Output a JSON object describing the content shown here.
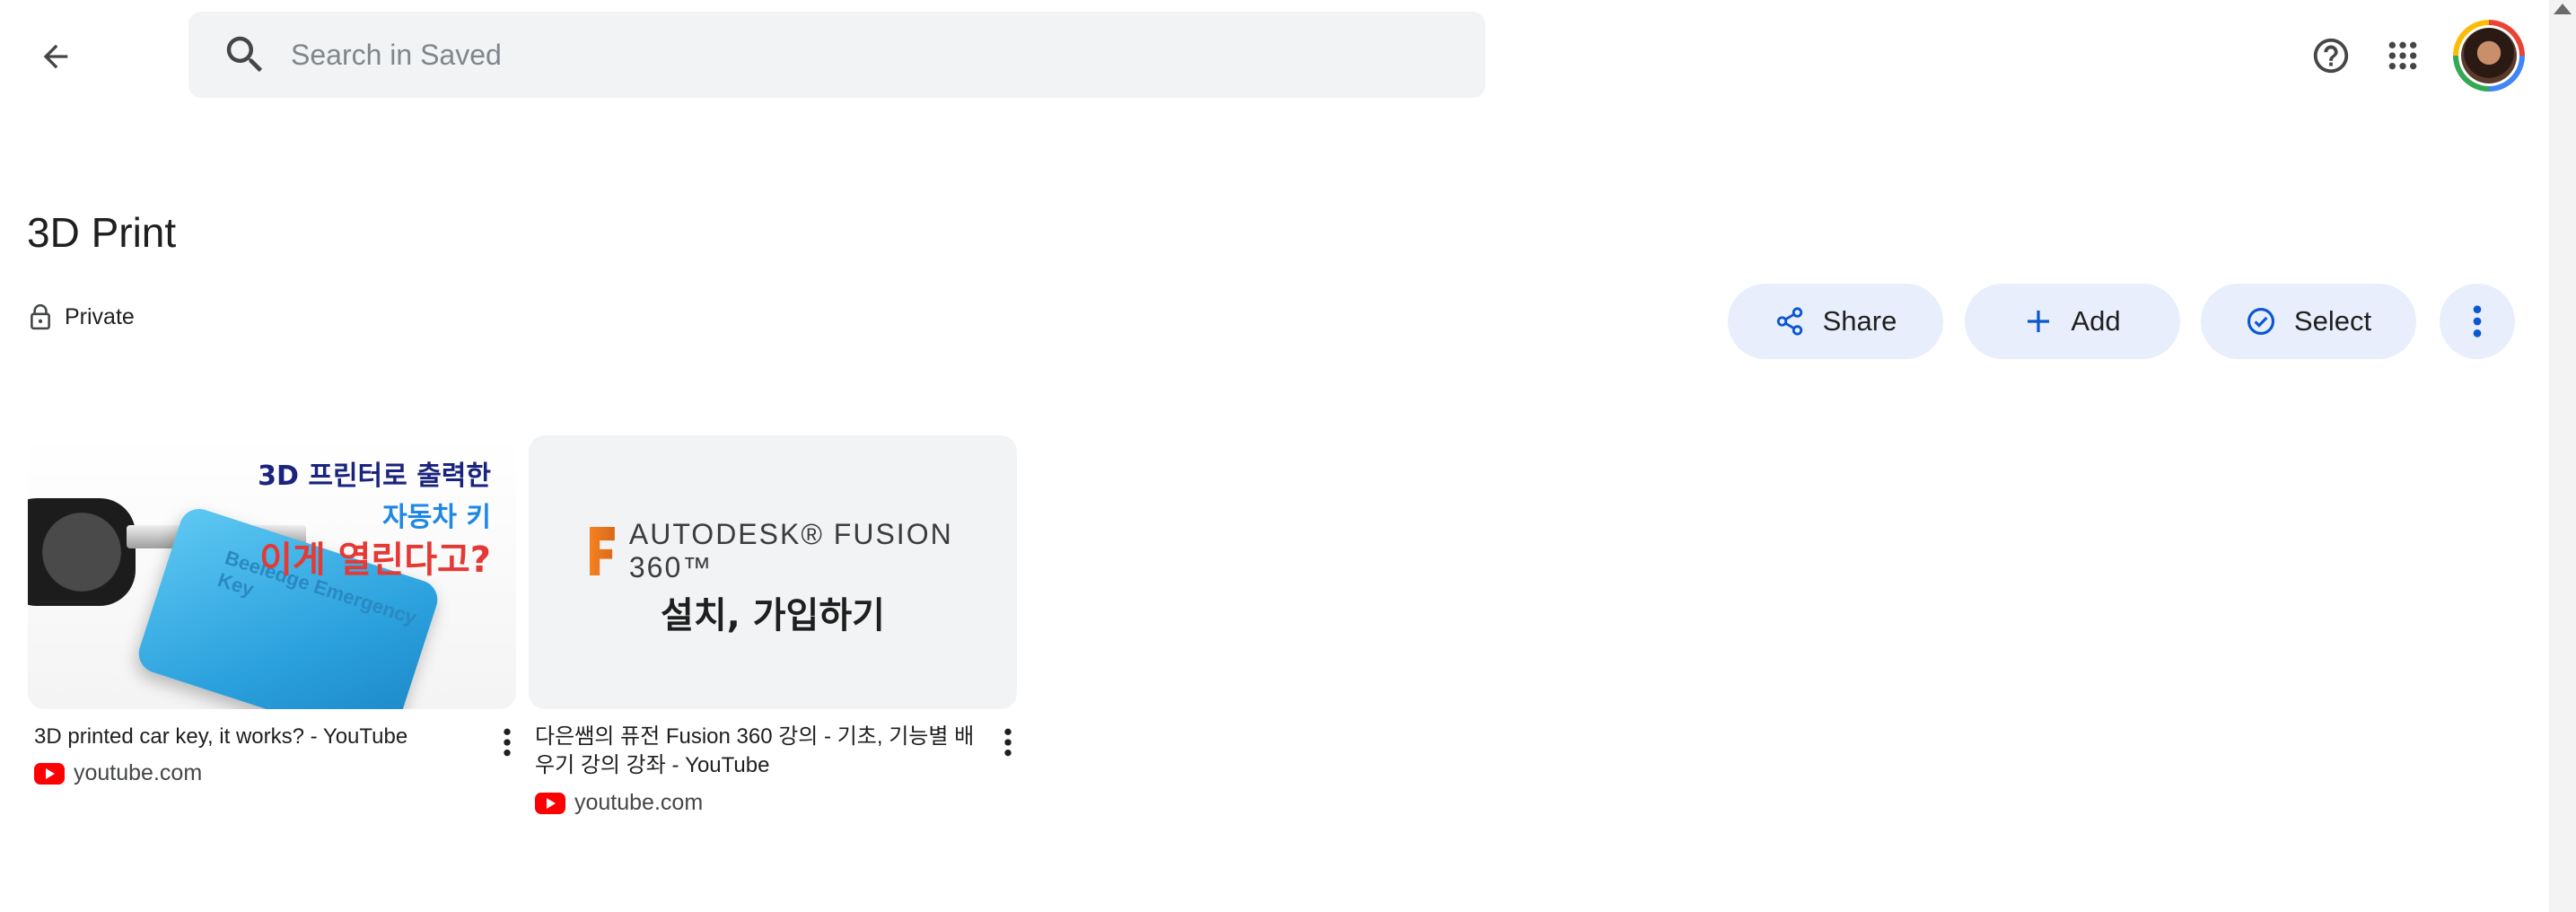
{
  "search": {
    "placeholder": "Search in Saved"
  },
  "collection": {
    "title": "3D Print",
    "privacy": "Private"
  },
  "actions": {
    "share": "Share",
    "add": "Add",
    "select": "Select"
  },
  "items": [
    {
      "title": "3D printed car key, it works? - YouTube",
      "source": "youtube.com",
      "thumb_lines": [
        "3D 프린터로 출력한",
        "자동차 키",
        "이게 열린다고?"
      ],
      "thumb_card_text": "Beeledge Emergency Key"
    },
    {
      "title": "다은쌤의 퓨전 Fusion 360 강의 - 기초, 기능별 배우기 강의 강좌 - YouTube",
      "source": "youtube.com",
      "thumb_brand": "AUTODESK® FUSION 360™",
      "thumb_sub": "설치, 가입하기"
    }
  ],
  "icons": {
    "back": "arrow-left",
    "search": "magnifier",
    "help": "question-circle",
    "apps": "grid-9-dots",
    "privacy": "lock",
    "share": "share-nodes",
    "add": "plus",
    "select": "check-circle",
    "more": "vertical-ellipsis"
  },
  "colors": {
    "accent": "#0b57d0",
    "pill_bg": "#e8eefb",
    "search_bg": "#f1f3f4",
    "youtube_red": "#ff0000"
  }
}
